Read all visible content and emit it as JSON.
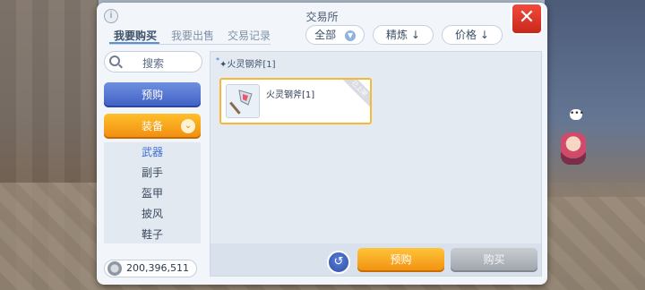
{
  "window": {
    "title": "交易所"
  },
  "tabs": [
    {
      "label": "我要购买",
      "active": true
    },
    {
      "label": "我要出售",
      "active": false
    },
    {
      "label": "交易记录",
      "active": false
    }
  ],
  "filters": {
    "all_label": "全部",
    "refine_label": "精炼",
    "price_label": "价格",
    "sort_arrow": "↓"
  },
  "sidebar": {
    "search_label": "搜索",
    "prebuy_label": "预购",
    "category_label": "装备",
    "subcategories": [
      "武器",
      "副手",
      "盔甲",
      "披风",
      "鞋子"
    ],
    "selected_subcategory": "武器"
  },
  "currency": {
    "amount": "200,396,511"
  },
  "results": {
    "title": "火灵钢斧[1]",
    "title_marker": "*",
    "items": [
      {
        "name": "火灵钢斧[1]",
        "icon": "axe-icon",
        "ribbon": "已上架"
      }
    ]
  },
  "footer": {
    "prebuy_label": "预购",
    "buy_label": "购买"
  },
  "colors": {
    "accent_orange": "#f08c10",
    "accent_blue": "#3f5fc4",
    "close_red": "#e0382a"
  }
}
